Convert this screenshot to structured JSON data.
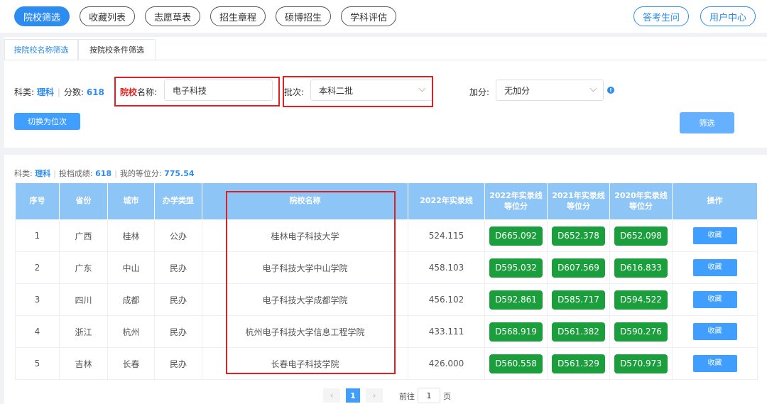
{
  "nav": {
    "tabs": [
      "院校筛选",
      "收藏列表",
      "志愿草表",
      "招生章程",
      "硕博招生",
      "学科评估"
    ],
    "right_buttons": [
      "答考生问",
      "用户中心"
    ]
  },
  "filter": {
    "tabs": [
      "按院校名称筛选",
      "按院校条件筛选"
    ],
    "subject_label": "科类:",
    "subject_value": "理科",
    "score_label": "分数:",
    "score_value": "618",
    "school_label_red": "院校",
    "school_label_rest": "名称:",
    "school_value": "电子科技",
    "batch_label": "批次:",
    "batch_value": "本科二批",
    "bonus_label": "加分:",
    "bonus_value": "无加分",
    "switch_button": "切换为位次",
    "filter_button": "筛选"
  },
  "results": {
    "subject_label": "科类:",
    "subject_value": "理科",
    "score_label": "投档成绩:",
    "score_value": "618",
    "rank_label": "我的等位分:",
    "rank_value": "775.54",
    "headers": [
      "序号",
      "省份",
      "城市",
      "办学类型",
      "院校名称",
      "2022年实录线",
      "2022年实录线\n等位分",
      "2021年实录线\n等位分",
      "2020年实录线\n等位分",
      "操作"
    ],
    "fav_label": "收藏",
    "rows": [
      {
        "no": "1",
        "province": "广西",
        "city": "桂林",
        "type": "公办",
        "name": "桂林电子科技大学",
        "line2022": "524.115",
        "r2022": "D665.092",
        "r2021": "D652.378",
        "r2020": "D652.098"
      },
      {
        "no": "2",
        "province": "广东",
        "city": "中山",
        "type": "民办",
        "name": "电子科技大学中山学院",
        "line2022": "458.103",
        "r2022": "D595.032",
        "r2021": "D607.569",
        "r2020": "D616.833"
      },
      {
        "no": "3",
        "province": "四川",
        "city": "成都",
        "type": "民办",
        "name": "电子科技大学成都学院",
        "line2022": "456.102",
        "r2022": "D592.861",
        "r2021": "D585.717",
        "r2020": "D594.522"
      },
      {
        "no": "4",
        "province": "浙江",
        "city": "杭州",
        "type": "民办",
        "name": "杭州电子科技大学信息工程学院",
        "line2022": "433.111",
        "r2022": "D568.919",
        "r2021": "D561.382",
        "r2020": "D590.276"
      },
      {
        "no": "5",
        "province": "吉林",
        "city": "长春",
        "type": "民办",
        "name": "长春电子科技学院",
        "line2022": "426.000",
        "r2022": "D560.558",
        "r2021": "D561.329",
        "r2020": "D570.973"
      }
    ]
  },
  "pagination": {
    "prev": "‹",
    "current": "1",
    "next": "›",
    "goto_label": "前往",
    "goto_value": "1",
    "page_label": "页"
  }
}
